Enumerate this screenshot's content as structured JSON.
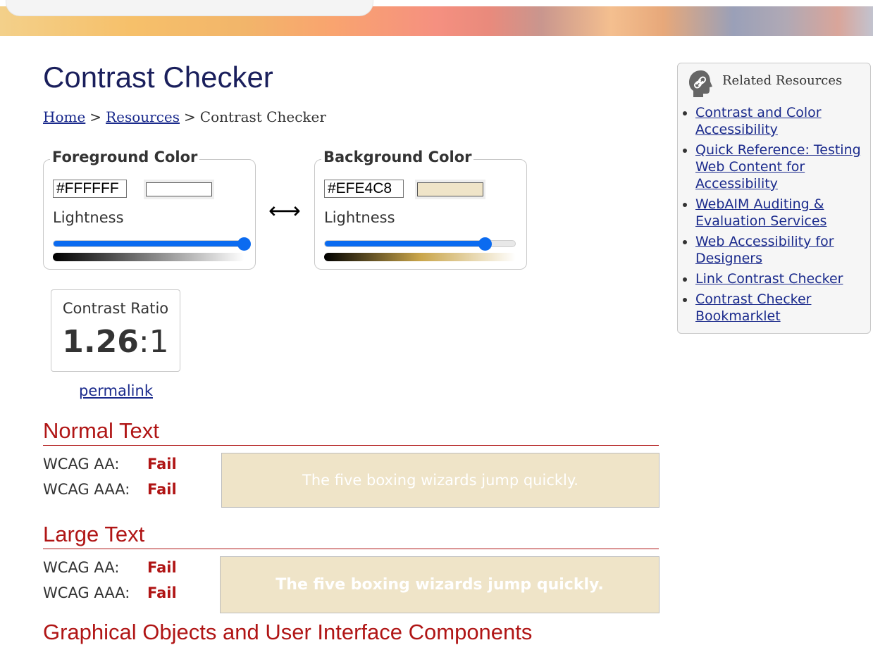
{
  "page": {
    "title": "Contrast Checker",
    "breadcrumb": {
      "home": "Home",
      "separator": ">",
      "resources": "Resources",
      "current": "Contrast Checker"
    }
  },
  "foreground": {
    "legend": "Foreground Color",
    "hex": "#FFFFFF",
    "swatch_color": "#FFFFFF",
    "lightness_label": "Lightness",
    "lightness_value": 1.0,
    "gradient_colors": [
      "#000000",
      "#ffffff"
    ]
  },
  "background": {
    "legend": "Background Color",
    "hex": "#EFE4C8",
    "swatch_color": "#EFE4C8",
    "lightness_label": "Lightness",
    "lightness_value": 0.84,
    "gradient_colors": [
      "#000000",
      "#c9a54a",
      "#ffffff"
    ]
  },
  "swap_icon": "swap-arrows-icon",
  "swap_glyph": "⟷",
  "contrast": {
    "label": "Contrast Ratio",
    "ratio_main": "1.26",
    "ratio_suffix": ":1",
    "permalink": "permalink"
  },
  "normal_text": {
    "heading": "Normal Text",
    "aa_label": "WCAG AA:",
    "aa_result": "Fail",
    "aaa_label": "WCAG AAA:",
    "aaa_result": "Fail",
    "sample": "The five boxing wizards jump quickly."
  },
  "large_text": {
    "heading": "Large Text",
    "aa_label": "WCAG AA:",
    "aa_result": "Fail",
    "aaa_label": "WCAG AAA:",
    "aaa_result": "Fail",
    "sample": "The five boxing wizards jump quickly."
  },
  "graphical": {
    "heading": "Graphical Objects and User Interface Components"
  },
  "related": {
    "heading": "Related Resources",
    "icon": "link-head-icon",
    "links": [
      "Contrast and Color Accessibility",
      "Quick Reference: Testing Web Content for Accessibility",
      "WebAIM Auditing & Evaluation Services",
      "Web Accessibility for Designers",
      "Link Contrast Checker",
      "Contrast Checker Bookmarklet"
    ]
  },
  "colors": {
    "heading": "#1a1f5c",
    "link": "#1a2a8c",
    "fail": "#b01515",
    "slider": "#0b6bf0"
  }
}
